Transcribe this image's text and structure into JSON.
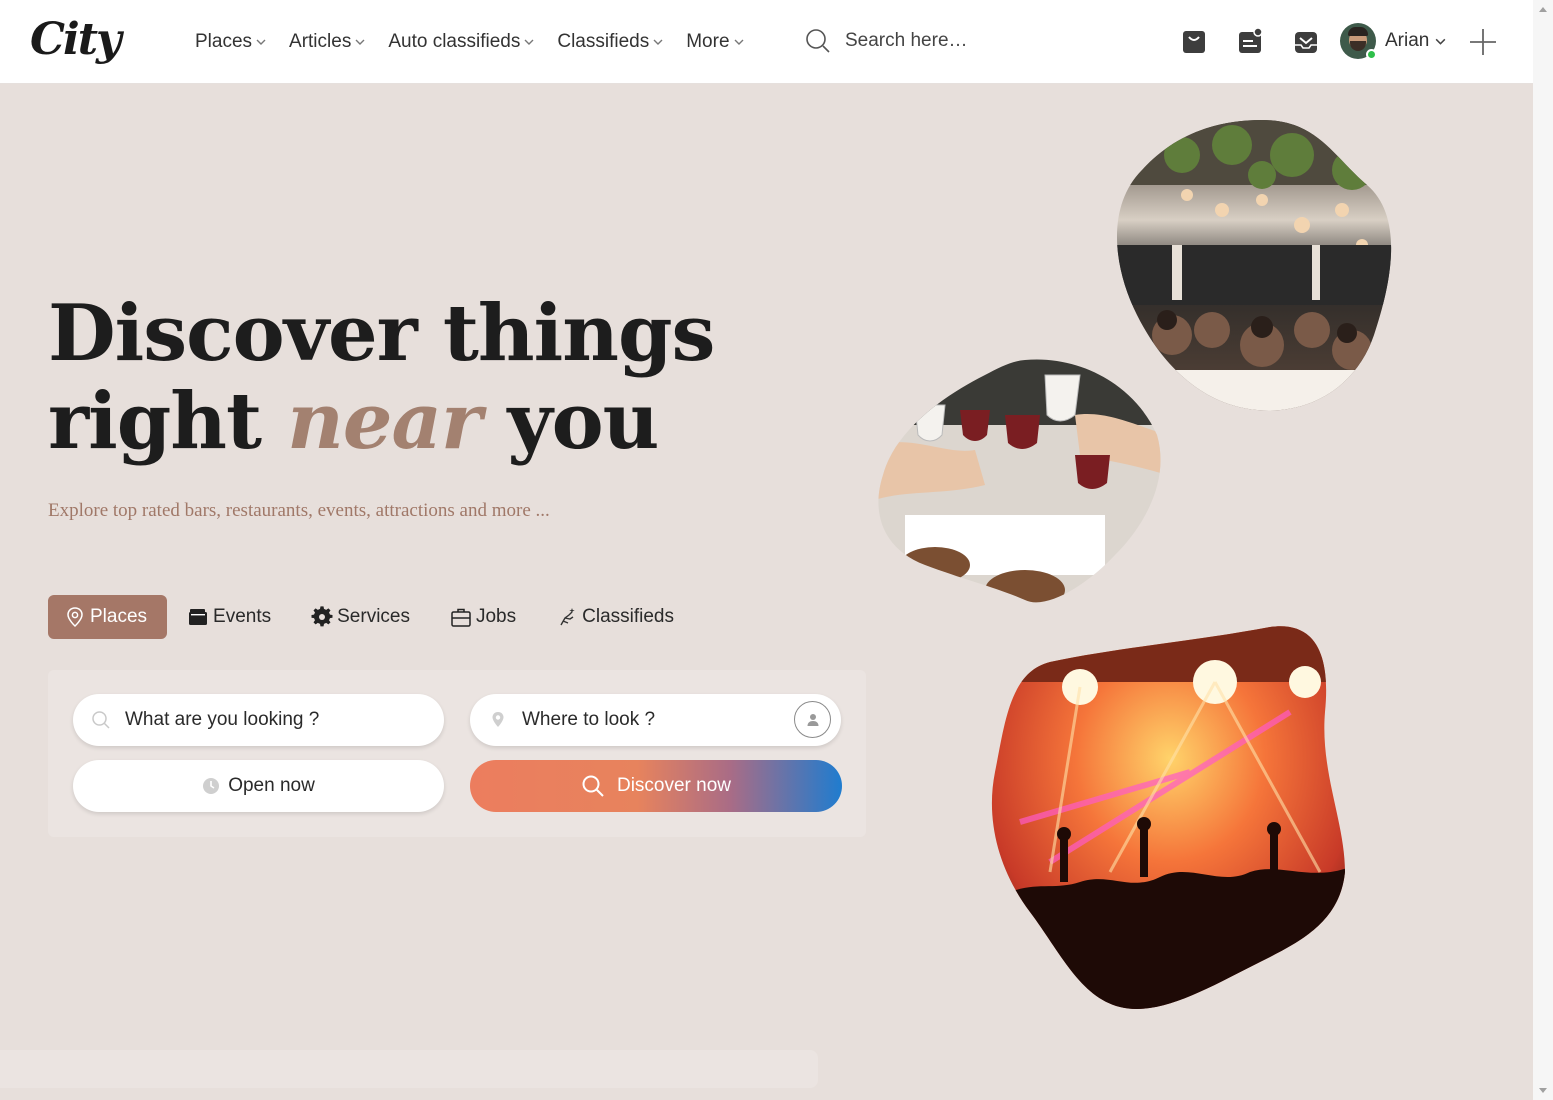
{
  "header": {
    "logo": "City",
    "nav": [
      {
        "label": "Places"
      },
      {
        "label": "Articles"
      },
      {
        "label": "Auto classifieds"
      },
      {
        "label": "Classifieds"
      },
      {
        "label": "More"
      }
    ],
    "search_placeholder": "Search here…",
    "icons": [
      "shopping-bag-icon",
      "notes-icon",
      "inbox-icon"
    ],
    "user": {
      "name": "Arian",
      "status": "online"
    }
  },
  "hero": {
    "title_line1": "Discover things",
    "title_line2_pre": "right",
    "title_line2_accent": "near",
    "title_line2_post": "you",
    "subtitle": "Explore top rated bars, restaurants, events, attractions and more ..."
  },
  "tabs": [
    {
      "label": "Places",
      "icon": "map-pin-icon",
      "active": true
    },
    {
      "label": "Events",
      "icon": "wallet-icon",
      "active": false
    },
    {
      "label": "Services",
      "icon": "gear-icon",
      "active": false
    },
    {
      "label": "Jobs",
      "icon": "briefcase-icon",
      "active": false
    },
    {
      "label": "Classifieds",
      "icon": "sparkle-hand-icon",
      "active": false
    }
  ],
  "search_form": {
    "what_placeholder": "What are you looking ?",
    "where_placeholder": "Where to look ?",
    "open_now_label": "Open now",
    "discover_label": "Discover now"
  },
  "colors": {
    "accent": "#a57767",
    "background": "#e7dfdb",
    "discover_gradient_start": "#ec7d5e",
    "discover_gradient_end": "#1f7ccf",
    "online": "#2fbf4a"
  },
  "images": [
    "restaurant-photo",
    "wine-toast-photo",
    "concert-photo"
  ]
}
